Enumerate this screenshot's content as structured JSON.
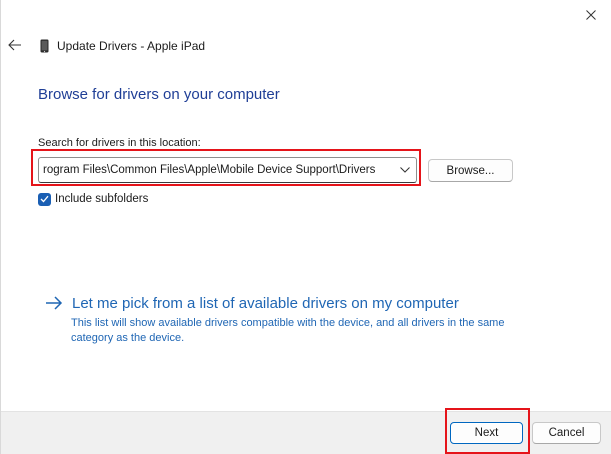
{
  "window": {
    "title": "Update Drivers - Apple iPad"
  },
  "page": {
    "heading": "Browse for drivers on your computer",
    "search_label": "Search for drivers in this location:",
    "path_value": "rogram Files\\Common Files\\Apple\\Mobile Device Support\\Drivers",
    "browse_label": "Browse...",
    "include_subfolders_label": "Include subfolders",
    "include_subfolders_checked": true
  },
  "pick_option": {
    "title": "Let me pick from a list of available drivers on my computer",
    "description": "This list will show available drivers compatible with the device, and all drivers in the same category as the device."
  },
  "footer": {
    "next_label": "Next",
    "cancel_label": "Cancel"
  },
  "colors": {
    "heading": "#1f3e96",
    "link": "#1f66b4",
    "checkbox": "#1a5fb4",
    "highlight": "#e5141a",
    "primary_border": "#0067c0",
    "footer_bg": "#f0f0f0"
  },
  "icons": {
    "close": "close-icon",
    "back": "back-arrow-icon",
    "device": "ipad-device-icon",
    "dropdown": "chevron-down-icon",
    "check": "checkmark-icon",
    "link_arrow": "right-arrow-icon"
  }
}
